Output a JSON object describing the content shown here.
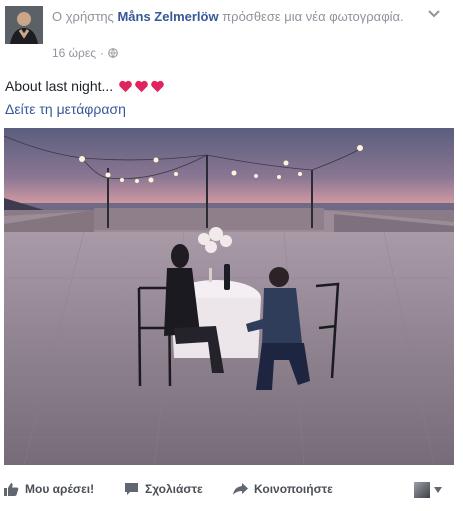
{
  "post": {
    "header_prefix": "Ο χρήστης ",
    "author": "Måns Zelmerlöw",
    "header_suffix": " πρόσθεσε μια νέα φωτογραφία.",
    "timestamp": "16 ώρες",
    "separator": "·",
    "privacy_icon": "globe-icon",
    "text": "About last night...",
    "emoji": [
      "heart",
      "heart",
      "heart"
    ],
    "translate_link": "Δείτε τη μετάφραση"
  },
  "actions": {
    "like_label": "Μου αρέσει!",
    "comment_label": "Σχολιάστε",
    "share_label": "Κοινοποιήστε"
  },
  "colors": {
    "link": "#365899",
    "meta": "#90949c",
    "heart": "#e0245e",
    "action_text": "#4b4f56"
  }
}
